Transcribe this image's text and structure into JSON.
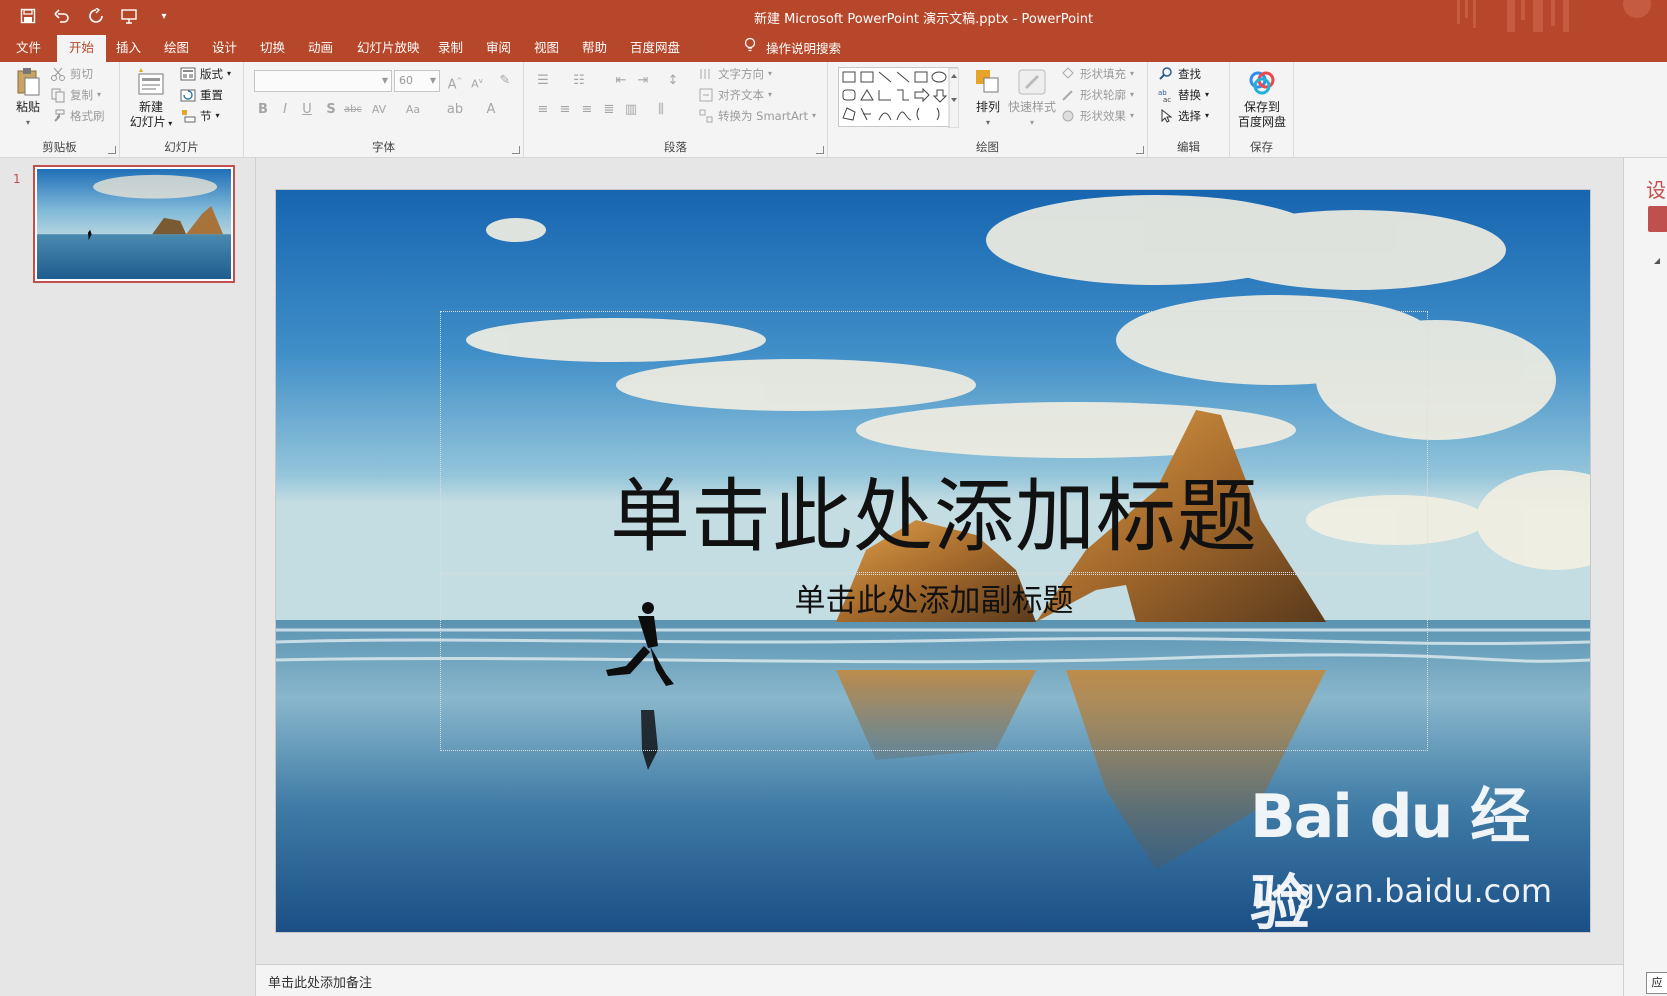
{
  "window": {
    "title": "新建 Microsoft PowerPoint 演示文稿.pptx  -  PowerPoint"
  },
  "tabs": [
    {
      "label": "文件",
      "active": false
    },
    {
      "label": "开始",
      "active": true
    },
    {
      "label": "插入",
      "active": false
    },
    {
      "label": "绘图",
      "active": false
    },
    {
      "label": "设计",
      "active": false
    },
    {
      "label": "切换",
      "active": false
    },
    {
      "label": "动画",
      "active": false
    },
    {
      "label": "幻灯片放映",
      "active": false
    },
    {
      "label": "录制",
      "active": false
    },
    {
      "label": "审阅",
      "active": false
    },
    {
      "label": "视图",
      "active": false
    },
    {
      "label": "帮助",
      "active": false
    },
    {
      "label": "百度网盘",
      "active": false
    }
  ],
  "tell_me": "操作说明搜索",
  "ribbon": {
    "clipboard": {
      "label": "剪贴板",
      "paste": "粘贴",
      "cut": "剪切",
      "copy": "复制",
      "format_painter": "格式刷"
    },
    "slides": {
      "label": "幻灯片",
      "new_slide_l1": "新建",
      "new_slide_l2": "幻灯片",
      "layout": "版式",
      "reset": "重置",
      "section": "节"
    },
    "font": {
      "label": "字体",
      "font_name": "",
      "font_size": "60",
      "bold": "B",
      "italic": "I",
      "underline": "U",
      "shadow": "S",
      "strike": "abc",
      "spacing": "AV",
      "case": "Aa",
      "grow": "A",
      "shrink": "A",
      "color": "A"
    },
    "paragraph": {
      "label": "段落",
      "text_direction": "文字方向",
      "align_text": "对齐文本",
      "smartart": "转换为 SmartArt"
    },
    "drawing": {
      "label": "绘图",
      "arrange": "排列",
      "quick_styles": "快速样式",
      "shape_fill": "形状填充",
      "shape_outline": "形状轮廓",
      "shape_effects": "形状效果"
    },
    "editing": {
      "label": "编辑",
      "find": "查找",
      "replace": "替换",
      "select": "选择"
    },
    "save": {
      "label": "保存",
      "save_l1": "保存到",
      "save_l2": "百度网盘"
    }
  },
  "thumbnails": [
    {
      "number": "1"
    }
  ],
  "slide": {
    "title_placeholder": "单击此处添加标题",
    "subtitle_placeholder": "单击此处添加副标题"
  },
  "watermark": {
    "logo": "Bai du 经验",
    "url": "jingyan.baidu.com"
  },
  "notes_placeholder": "单击此处添加备注",
  "right_pane": {
    "label": "设",
    "corner": "应"
  },
  "colors": {
    "accent": "#b7472a",
    "selection": "#c0504d",
    "ribbon_bg": "#f4f4f4"
  }
}
